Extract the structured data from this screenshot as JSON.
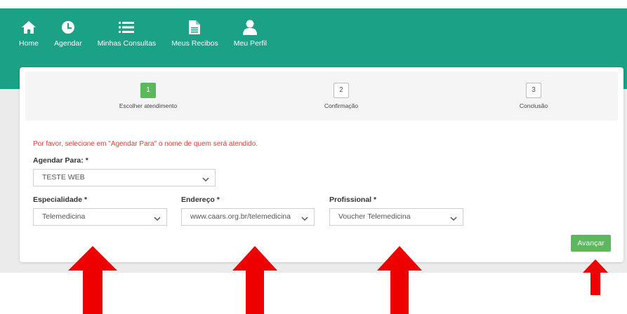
{
  "nav": [
    {
      "label": "Home",
      "icon": "home-icon"
    },
    {
      "label": "Agendar",
      "icon": "clock-icon"
    },
    {
      "label": "Minhas Consultas",
      "icon": "list-icon"
    },
    {
      "label": "Meus Recibos",
      "icon": "document-icon"
    },
    {
      "label": "Meu Perfil",
      "icon": "user-icon"
    }
  ],
  "steps": [
    {
      "number": "1",
      "label": "Escolher atendimento",
      "active": true
    },
    {
      "number": "2",
      "label": "Confirmação",
      "active": false
    },
    {
      "number": "3",
      "label": "Conclusão",
      "active": false
    }
  ],
  "notice": "Por favor, selecione em \"Agendar Para\" o nome de quem será atendido.",
  "form": {
    "agendar_para": {
      "label": "Agendar Para: *",
      "value": "TESTE WEB"
    },
    "especialidade": {
      "label": "Especialidade *",
      "value": "Telemedicina"
    },
    "endereco": {
      "label": "Endereço *",
      "value": "www.caars.org.br/telemedicina"
    },
    "profissional": {
      "label": "Profissional *",
      "value": "Voucher Telemedicina"
    }
  },
  "submit_label": "Avançar",
  "colors": {
    "header": "#1aa186",
    "accent_green": "#5cb85c",
    "notice_red": "#e53935",
    "arrow_red": "#ee0000"
  }
}
